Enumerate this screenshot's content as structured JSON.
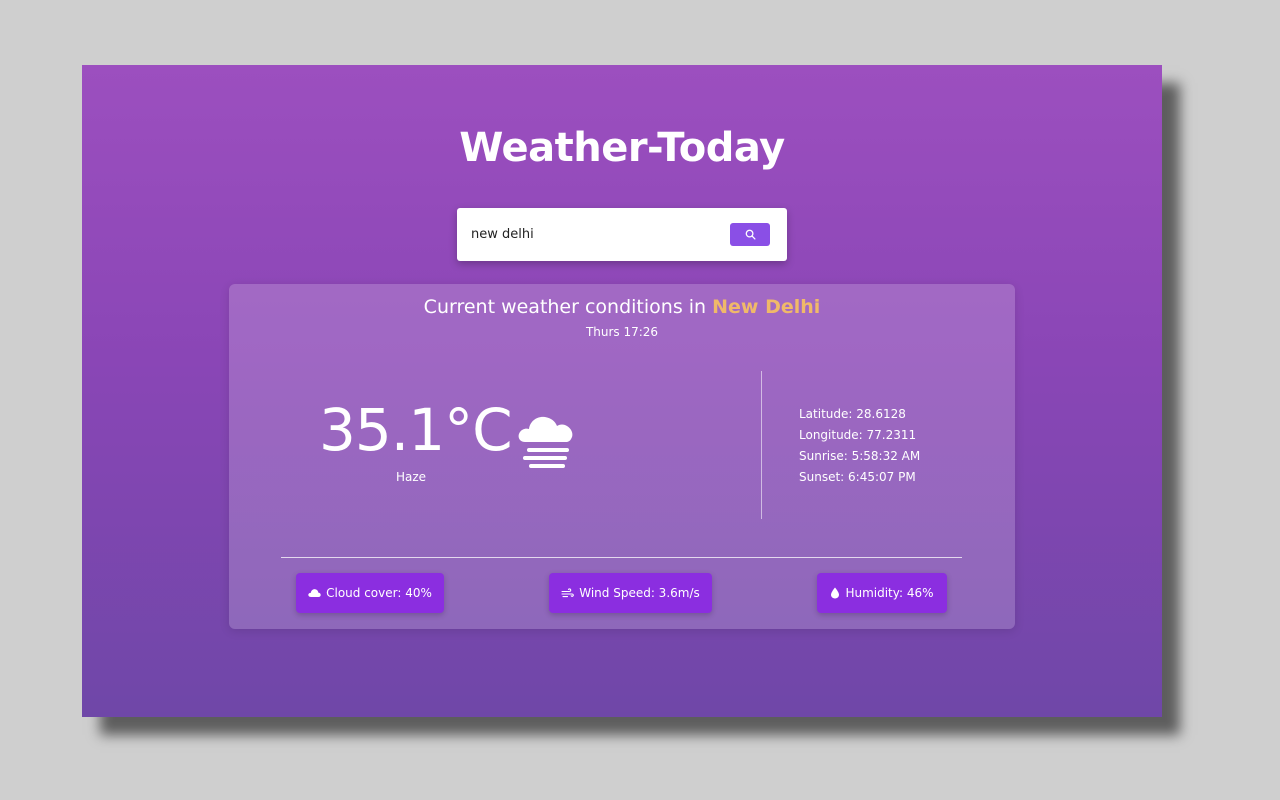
{
  "app": {
    "title": "Weather-Today"
  },
  "search": {
    "value": "new delhi",
    "button_icon": "search-icon"
  },
  "weather": {
    "heading_prefix": "Current weather conditions in",
    "city": "New Delhi",
    "time": "Thurs 17:26",
    "temperature": "35.1°C",
    "condition": "Haze",
    "condition_icon": "haze-icon",
    "details": {
      "latitude": "Latitude: 28.6128",
      "longitude": "Longitude: 77.2311",
      "sunrise": "Sunrise: 5:58:32 AM",
      "sunset": "Sunset: 6:45:07 PM"
    },
    "stats": {
      "cloud_cover": "Cloud cover: 40%",
      "wind_speed": "Wind Speed: 3.6m/s",
      "humidity": "Humidity: 46%"
    }
  },
  "colors": {
    "accent": "#8b2ee0",
    "search_button": "#8a4fe6",
    "city_highlight": "#f0b969",
    "background_top": "#9c4fbf",
    "background_bottom": "#6f47a8"
  }
}
